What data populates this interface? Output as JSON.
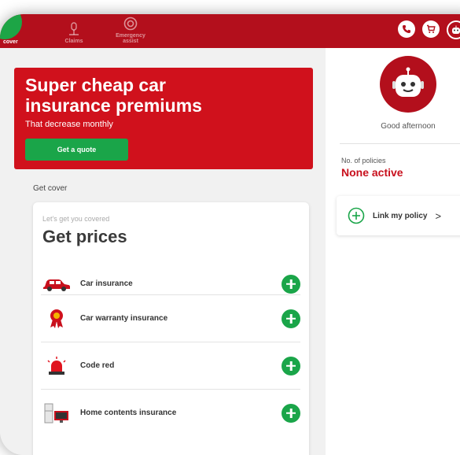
{
  "nav": {
    "cover_label": "cover",
    "claims_label": "Claims",
    "emergency_label_line1": "Emergency",
    "emergency_label_line2": "assist",
    "phone_icon": "phone-icon",
    "cart_icon": "cart-icon",
    "avatar_icon": "robot-avatar-icon"
  },
  "hero": {
    "title_line1": "Super cheap car",
    "title_line2": "insurance premiums",
    "subtitle": "That decrease monthly",
    "cta": "Get a quote"
  },
  "section_label": "Get cover",
  "card": {
    "kicker": "Let's get you covered",
    "title": "Get prices",
    "items": [
      {
        "label": "Car insurance",
        "icon": "car-icon"
      },
      {
        "label": "Car warranty insurance",
        "icon": "warranty-badge-icon"
      },
      {
        "label": "Code red",
        "icon": "siren-icon"
      },
      {
        "label": "Home contents insurance",
        "icon": "home-contents-icon"
      }
    ]
  },
  "profile": {
    "greeting": "Good afternoon",
    "policies_label": "No. of policies",
    "policies_value": "None active",
    "link_label": "Link my policy",
    "link_arrow": ">"
  },
  "colors": {
    "brand_red": "#b30f1c",
    "hero_red": "#d0111c",
    "green": "#1aa549"
  }
}
